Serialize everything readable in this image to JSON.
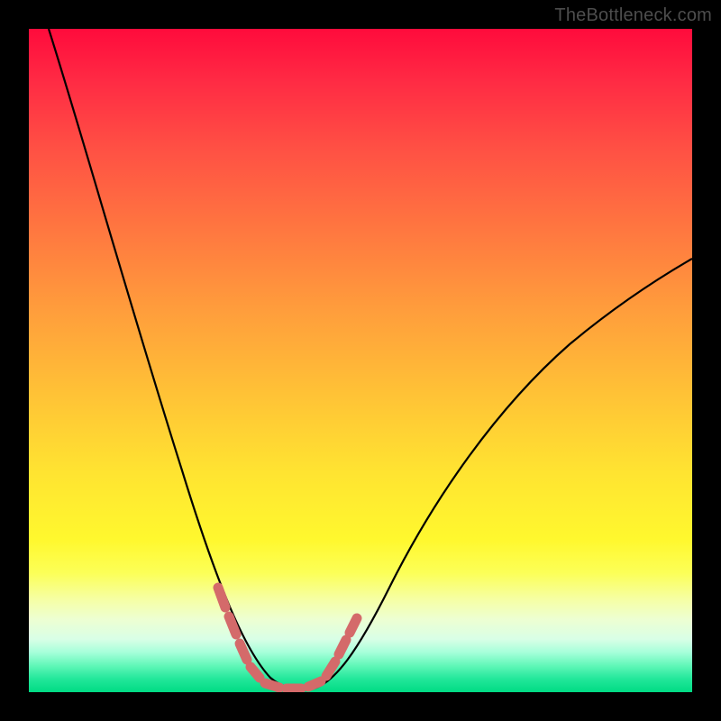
{
  "watermark": "TheBottleneck.com",
  "colors": {
    "frame": "#000000",
    "curve": "#000000",
    "highlight": "#d46a6a"
  },
  "chart_data": {
    "type": "line",
    "title": "",
    "xlabel": "",
    "ylabel": "",
    "xlim": [
      0,
      100
    ],
    "ylim": [
      0,
      100
    ],
    "series": [
      {
        "name": "bottleneck-curve",
        "x": [
          3,
          6,
          10,
          14,
          18,
          22,
          26,
          29,
          31,
          33,
          35,
          37,
          39,
          41,
          43,
          46,
          50,
          55,
          60,
          66,
          72,
          78,
          84,
          90,
          96,
          100
        ],
        "y": [
          100,
          88,
          74,
          62,
          51,
          41,
          32,
          23,
          17,
          12,
          8,
          4,
          2,
          0.5,
          0.5,
          2,
          6,
          12,
          19,
          27,
          34,
          41,
          47,
          53,
          58,
          62
        ]
      }
    ],
    "annotations": [
      {
        "name": "optimal-range-marker",
        "type": "highlight",
        "x_range": [
          29,
          46
        ],
        "note": "Salmon dashed band around curve bottom"
      }
    ]
  }
}
